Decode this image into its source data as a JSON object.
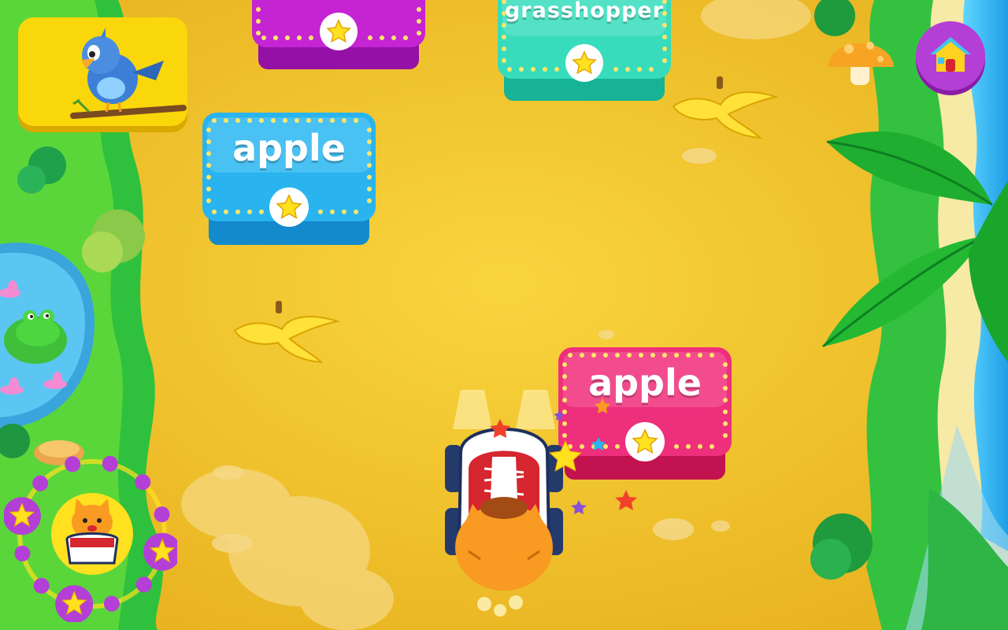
{
  "game": {
    "word_boxes": [
      {
        "word": "",
        "color": "#c524d3",
        "edge": "#9510a6"
      },
      {
        "word": "grasshopper",
        "color": "#37dcbc",
        "edge": "#16b396"
      },
      {
        "word": "apple",
        "color": "#2ab4ef",
        "edge": "#138acb"
      },
      {
        "word": "apple",
        "color": "#ee2f7c",
        "edge": "#c2124f"
      }
    ],
    "hud": {
      "bird_card": {
        "icon": "blue-bird-icon",
        "color": "#f9d70b"
      },
      "home_button": {
        "icon": "house-icon",
        "color": "#b43fd6"
      },
      "progress": {
        "stars_earned": 3,
        "total_slots": 12,
        "icon": "star-icon"
      }
    },
    "player": {
      "character": "orange-cat",
      "vehicle": "sneaker-car"
    },
    "obstacles": [
      "banana-peel",
      "banana-peel"
    ]
  }
}
